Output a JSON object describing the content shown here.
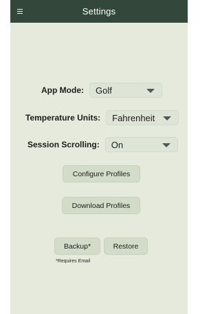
{
  "header": {
    "title": "Settings",
    "menu_icon": "hamburger-menu-icon"
  },
  "settings": {
    "app_mode": {
      "label": "App Mode:",
      "value": "Golf"
    },
    "temperature_units": {
      "label": "Temperature Units:",
      "value": "Fahrenheit"
    },
    "session_scrolling": {
      "label": "Session Scrolling:",
      "value": "On"
    }
  },
  "buttons": {
    "configure_profiles": "Configure Profiles",
    "download_profiles": "Download Profiles",
    "backup": "Backup*",
    "restore": "Restore"
  },
  "footnote": "*Requires Email",
  "colors": {
    "header_bg": "#33473a",
    "screen_bg": "#e5eadd",
    "button_bg": "#d3dcc9"
  }
}
